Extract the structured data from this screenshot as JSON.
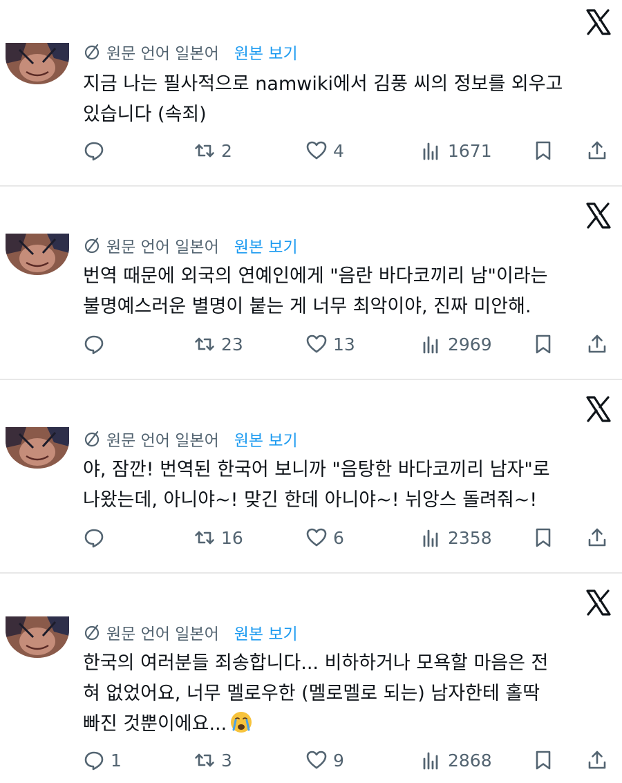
{
  "colors": {
    "text": "#0f1419",
    "muted": "#536471",
    "link": "#1d9bf0",
    "divider": "#e8e8e8"
  },
  "icons": [
    "x-logo-icon",
    "translate-icon",
    "reply-icon",
    "retweet-icon",
    "like-icon",
    "views-icon",
    "bookmark-icon",
    "share-icon",
    "crying-emoji"
  ],
  "tweets": [
    {
      "meta": "원문 언어 일본어",
      "show_original": "원본 보기",
      "text": "지금 나는 필사적으로 namwiki에서 김풍 씨의 정보를 외우고\n있습니다 (속죄)",
      "replies": "",
      "retweets": "2",
      "likes": "4",
      "views": "1671"
    },
    {
      "meta": "원문 언어 일본어",
      "show_original": "원본 보기",
      "text": "번역 때문에 외국의 연예인에게 \"음란 바다코끼리 남\"이라는\n불명예스러운 별명이 붙는 게 너무 최악이야, 진짜 미안해.",
      "replies": "",
      "retweets": "23",
      "likes": "13",
      "views": "2969"
    },
    {
      "meta": "원문 언어 일본어",
      "show_original": "원본 보기",
      "text": "야, 잠깐! 번역된 한국어 보니까 \"음탕한 바다코끼리 남자\"로\n나왔는데, 아니야~! 맞긴 한데 아니야~! 뉘앙스 돌려줘~!",
      "replies": "",
      "retweets": "16",
      "likes": "6",
      "views": "2358"
    },
    {
      "meta": "원문 언어 일본어",
      "show_original": "원본 보기",
      "text": "한국의 여러분들 죄송합니다... 비하하거나 모욕할 마음은 전\n혀 없었어요, 너무 멜로우한 (멜로멜로 되는) 남자한테 홀딱\n빠진 것뿐이에요...",
      "replies": "1",
      "retweets": "3",
      "likes": "9",
      "views": "2868"
    }
  ]
}
